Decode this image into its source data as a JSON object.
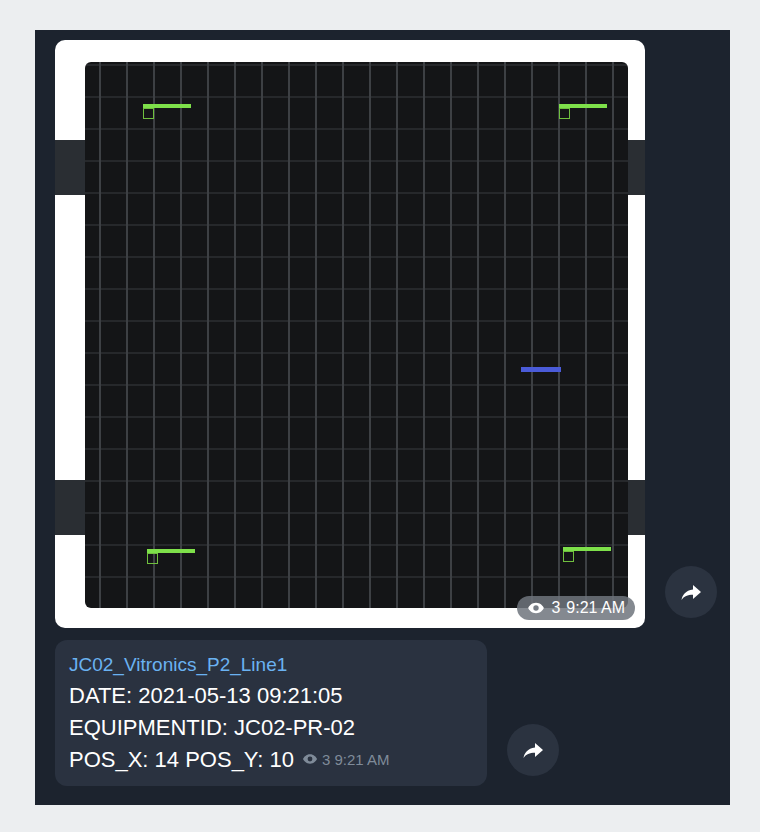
{
  "photo_message": {
    "views": "3",
    "time": "9:21 AM"
  },
  "caption_message": {
    "sender": "JC02_Vitronics_P2_Line1",
    "lines": [
      "DATE: 2021-05-13 09:21:05",
      "EQUIPMENTID: JC02-PR-02",
      "POS_X: 14 POS_Y: 10"
    ],
    "views": "3",
    "time": "9:21 AM"
  }
}
